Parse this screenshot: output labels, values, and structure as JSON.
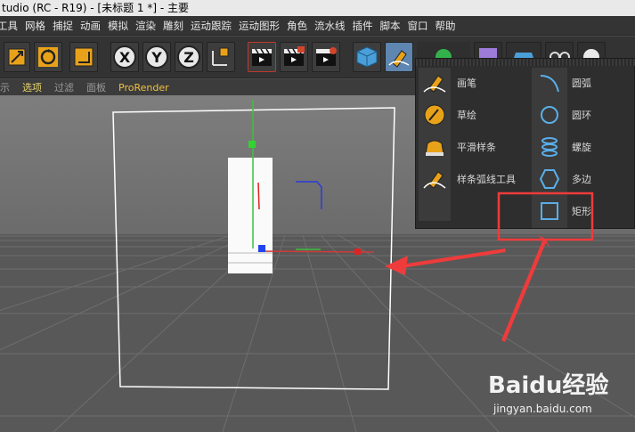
{
  "window": {
    "title": "tudio (RC - R19) - [未标题 1 *] - 主要"
  },
  "menu": [
    "工具",
    "网格",
    "捕捉",
    "动画",
    "模拟",
    "渲染",
    "雕刻",
    "运动跟踪",
    "运动图形",
    "角色",
    "流水线",
    "插件",
    "脚本",
    "窗口",
    "帮助"
  ],
  "tabs": [
    {
      "label": "示",
      "active": false
    },
    {
      "label": "选项",
      "active": true
    },
    {
      "label": "过滤",
      "active": false
    },
    {
      "label": "面板",
      "active": false
    },
    {
      "label": "ProRender",
      "active": false
    }
  ],
  "toolbar": {
    "axis_x": "X",
    "axis_y": "Y",
    "axis_z": "Z"
  },
  "spline_menu": {
    "left": [
      {
        "label": "画笔",
        "icon": "pen-icon"
      },
      {
        "label": "草绘",
        "icon": "sketch-icon"
      },
      {
        "label": "平滑样条",
        "icon": "smooth-spline-icon"
      },
      {
        "label": "样条弧线工具",
        "icon": "spline-arc-tool-icon"
      }
    ],
    "right": [
      {
        "label": "圆弧",
        "icon": "arc-icon"
      },
      {
        "label": "圆环",
        "icon": "circle-icon"
      },
      {
        "label": "螺旋",
        "icon": "helix-icon"
      },
      {
        "label": "多边",
        "icon": "polygon-icon"
      },
      {
        "label": "矩形",
        "icon": "rectangle-icon"
      }
    ]
  },
  "colors": {
    "accent_yellow": "#e8a21a",
    "selected_blue": "#5e86b0",
    "annotation_red": "#ee3b3b"
  },
  "watermark": {
    "logo": "Baidu经验",
    "url": "jingyan.baidu.com"
  }
}
